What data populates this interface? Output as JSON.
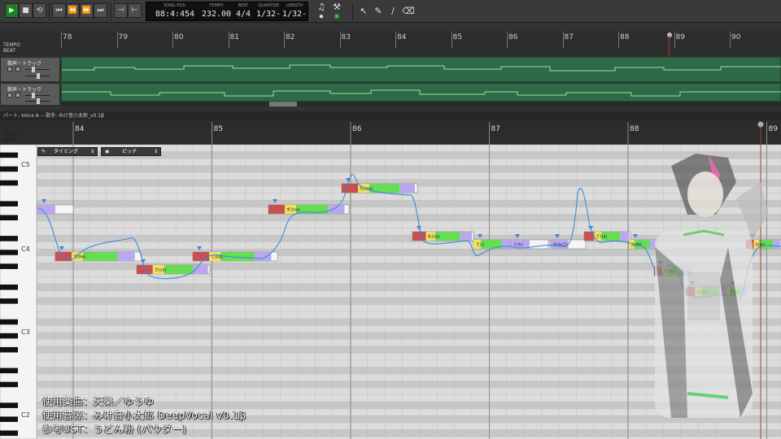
{
  "toolbar": {
    "buttons": [
      {
        "name": "play-button",
        "icon": "play-icon",
        "glyph": "▶"
      },
      {
        "name": "stop-button",
        "icon": "stop-icon",
        "glyph": "■"
      },
      {
        "name": "loop-button",
        "icon": "loop-icon",
        "glyph": "⟲"
      },
      {
        "name": "goto-start-button",
        "icon": "skip-start-icon",
        "glyph": "⏮"
      },
      {
        "name": "rewind-button",
        "icon": "rewind-icon",
        "glyph": "⏪"
      },
      {
        "name": "fast-forward-button",
        "icon": "fast-forward-icon",
        "glyph": "⏩"
      },
      {
        "name": "goto-end-button",
        "icon": "skip-end-icon",
        "glyph": "⏭"
      },
      {
        "name": "marker-left-button",
        "icon": "marker-icon",
        "glyph": "⊣"
      },
      {
        "name": "marker-right-button",
        "icon": "marker-icon",
        "glyph": "⊢"
      }
    ],
    "lcd": {
      "song_pos_label": "SONG POS.",
      "song_pos": "88:4:454",
      "tempo_label": "TEMPO",
      "tempo": "232.00",
      "beat_label": "BEAT",
      "beat": "4/4",
      "quantize_label": "QUANTIZE",
      "quantize": "1/32-",
      "length_label": "LENGTH",
      "length": "1/32-"
    },
    "tool_glyphs": {
      "note": "♫",
      "metronome": "⚒",
      "pointer": "↖",
      "pencil": "✎",
      "line": "∕",
      "eraser": "⌫"
    }
  },
  "arrangement": {
    "ruler_tempo": "TEMPO",
    "ruler_beat": "BEAT",
    "bars": [
      "78",
      "79",
      "80",
      "81",
      "82",
      "83",
      "84",
      "85",
      "86",
      "87",
      "88",
      "89",
      "90"
    ],
    "tracks": [
      {
        "label": "歌声・トラック"
      },
      {
        "label": "歌声・トラック"
      }
    ]
  },
  "pianoroll": {
    "header": "パート: Voice A  --  歌手: みけ音小太郎_v0.1β",
    "ruler_tempo": "TEMPO",
    "ruler_beat": "BEAT",
    "bars": [
      "84",
      "85",
      "86",
      "87",
      "88",
      "89"
    ],
    "timing_label": "タイミング",
    "pitch_label": "ピッチ",
    "octave_labels": [
      "C5",
      "C4",
      "C3",
      "C2"
    ],
    "notes": [
      {
        "lyric": "",
        "pitch": "C4+8"
      },
      {
        "lyric": "て(Re)",
        "pitch": "C4"
      },
      {
        "lyric": "さ(sa)",
        "pitch": "B3"
      },
      {
        "lyric": "て(ka)",
        "pitch": "C4"
      },
      {
        "lyric": "ず(ma)",
        "pitch": "F4"
      },
      {
        "lyric": "た(wa)",
        "pitch": "G4"
      },
      {
        "lyric": "な(na)",
        "pitch": "D4"
      },
      {
        "lyric": "て(i)",
        "pitch": "D4"
      },
      {
        "lyric": "ぐ(k)",
        "pitch": "C#4"
      },
      {
        "lyric": "お(bc1)",
        "pitch": "D4"
      },
      {
        "lyric": "て(ta)",
        "pitch": "D4"
      },
      {
        "lyric": "ん(N)",
        "pitch": "D4"
      },
      {
        "lyric": "で(de)",
        "pitch": "B3"
      },
      {
        "lyric": "た(ka)",
        "pitch": "A3"
      },
      {
        "lyric": "ら(ra)",
        "pitch": "A3"
      },
      {
        "lyric": "わ(o)",
        "pitch": "C4"
      }
    ]
  },
  "credits": {
    "line1": "使用楽曲：天樂／ゆうゆ",
    "line2": "使用音源：みけ音小太郎 DeepVocal v0.1β",
    "line3": "参考UST：うどん粉 (パウダー)"
  }
}
